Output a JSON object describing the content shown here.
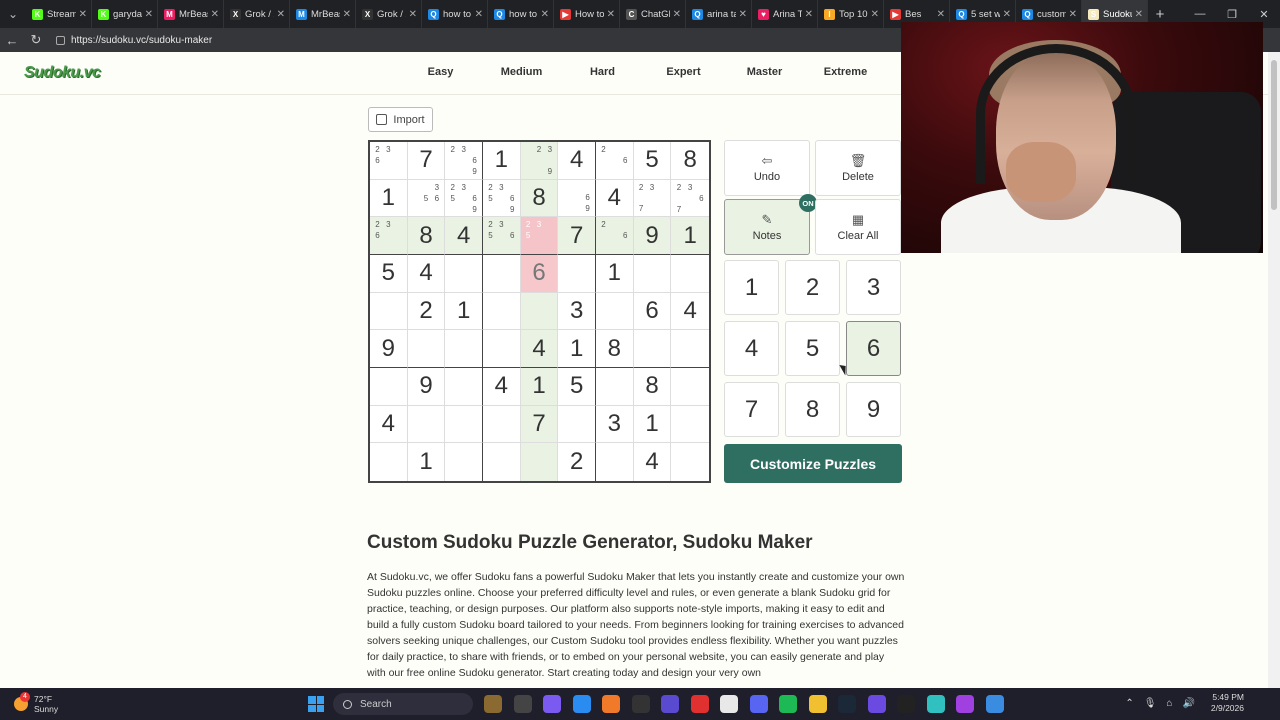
{
  "browser": {
    "tabs": [
      {
        "label": "Stream",
        "color": "#53fc18",
        "glyph": "K"
      },
      {
        "label": "garydan",
        "color": "#53fc18",
        "glyph": "K"
      },
      {
        "label": "MrBeast",
        "color": "#e91e63",
        "glyph": "M"
      },
      {
        "label": "Grok / X",
        "color": "#333",
        "glyph": "X"
      },
      {
        "label": "MrBeast",
        "color": "#1e88e5",
        "glyph": "M"
      },
      {
        "label": "Grok / X",
        "color": "#333",
        "glyph": "X"
      },
      {
        "label": "how to",
        "color": "#1e88e5",
        "glyph": "Q"
      },
      {
        "label": "how to",
        "color": "#1e88e5",
        "glyph": "Q"
      },
      {
        "label": "How to",
        "color": "#e53935",
        "glyph": "▶"
      },
      {
        "label": "ChatGPT",
        "color": "#555",
        "glyph": "C"
      },
      {
        "label": "arina ta",
        "color": "#1e88e5",
        "glyph": "Q"
      },
      {
        "label": "Arina Ta",
        "color": "#e91e63",
        "glyph": "♥"
      },
      {
        "label": "Top 10",
        "color": "#f9a825",
        "glyph": "I"
      },
      {
        "label": "Bes",
        "color": "#e53935",
        "glyph": "▶"
      },
      {
        "label": "5 set w",
        "color": "#1e88e5",
        "glyph": "Q"
      },
      {
        "label": "custom",
        "color": "#1e88e5",
        "glyph": "Q"
      },
      {
        "label": "Sudoku",
        "color": "#f5e9c0",
        "glyph": "S"
      }
    ],
    "url": "https://sudoku.vc/sudoku-maker"
  },
  "site": {
    "logo": "Sudoku.vc",
    "nav": [
      "Easy",
      "Medium",
      "Hard",
      "Expert",
      "Master",
      "Extreme"
    ],
    "import_label": "Import"
  },
  "grid": {
    "cells": [
      {
        "n": "2 3 _ 6"
      },
      {
        "v": "7"
      },
      {
        "n": "2 3 _ _ _ 6 _ _ 9"
      },
      {
        "v": "1"
      },
      {
        "n": "_ 2 3 _ _ _ _ _ 9",
        "hl": 1
      },
      {
        "v": "4"
      },
      {
        "n": "2 _ _ _ _ 6"
      },
      {
        "v": "5"
      },
      {
        "v": "8"
      },
      {
        "v": "1"
      },
      {
        "n": "_ _ 3 _ 5 6"
      },
      {
        "n": "2 3 _ 5 _ 6 _ _ 9"
      },
      {
        "n": "2 3 _ 5 _ 6 _ _ 9"
      },
      {
        "v": "8",
        "hl": 1
      },
      {
        "n": "_ _ _ _ _ 6 _ _ 9"
      },
      {
        "v": "4"
      },
      {
        "n": "2 3 _ _ _ _ 7"
      },
      {
        "n": "2 3 _ _ _ 6 7"
      },
      {
        "n": "2 3 _ 6",
        "hl": 1
      },
      {
        "v": "8",
        "hl": 1
      },
      {
        "v": "4",
        "hl": 1
      },
      {
        "n": "2 3 _ 5 _ 6",
        "hl": 1
      },
      {
        "n": "2 3 _ 5",
        "sel": 1
      },
      {
        "v": "7",
        "hl": 1
      },
      {
        "n": "2 _ _ _ _ 6",
        "hl": 1
      },
      {
        "v": "9",
        "hl": 1
      },
      {
        "v": "1",
        "hl": 1
      },
      {
        "v": "5"
      },
      {
        "v": "4"
      },
      {},
      {},
      {
        "v": "6",
        "focus": 1,
        "user": 1
      },
      {},
      {
        "v": "1"
      },
      {},
      {},
      {},
      {
        "v": "2"
      },
      {
        "v": "1"
      },
      {},
      {
        "hl": 1
      },
      {
        "v": "3"
      },
      {},
      {
        "v": "6"
      },
      {
        "v": "4"
      },
      {
        "v": "9"
      },
      {},
      {},
      {},
      {
        "v": "4",
        "hl": 1
      },
      {
        "v": "1"
      },
      {
        "v": "8"
      },
      {},
      {},
      {},
      {
        "v": "9"
      },
      {},
      {
        "v": "4"
      },
      {
        "v": "1",
        "hl": 1
      },
      {
        "v": "5"
      },
      {},
      {
        "v": "8"
      },
      {},
      {
        "v": "4"
      },
      {},
      {},
      {},
      {
        "v": "7",
        "hl": 1
      },
      {},
      {
        "v": "3"
      },
      {
        "v": "1"
      },
      {},
      {},
      {
        "v": "1"
      },
      {},
      {},
      {
        "hl": 1
      },
      {
        "v": "2"
      },
      {},
      {
        "v": "4"
      },
      {}
    ]
  },
  "controls": {
    "undo": "Undo",
    "delete": "Delete",
    "notes": "Notes",
    "notes_badge": "ON",
    "clear_all": "Clear All",
    "numbers": [
      "1",
      "2",
      "3",
      "4",
      "5",
      "6",
      "7",
      "8",
      "9"
    ],
    "active_number": "6",
    "customize": "Customize Puzzles"
  },
  "article": {
    "title": "Custom Sudoku Puzzle Generator, Sudoku Maker",
    "body": "At Sudoku.vc, we offer Sudoku fans a powerful Sudoku Maker that lets you instantly create and customize your own Sudoku puzzles online. Choose your preferred difficulty level and rules, or even generate a blank Sudoku grid for practice, teaching, or design purposes. Our platform also supports note-style imports, making it easy to edit and build a fully custom Sudoku board tailored to your needs. From beginners looking for training exercises to advanced solvers seeking unique challenges, our Custom Sudoku tool provides endless flexibility. Whether you want puzzles for daily practice, to share with friends, or to embed on your personal website, you can easily generate and play with our free online Sudoku generator. Start creating today and design your very own"
  },
  "taskbar": {
    "weather_temp": "72°F",
    "weather_desc": "Sunny",
    "weather_badge": "4",
    "search_label": "Search",
    "time": "5:49 PM",
    "date": "2/9/2026",
    "icon_colors": [
      "#8a6a30",
      "#444",
      "#7a5af0",
      "#2a8cf0",
      "#f07a2a",
      "#333",
      "#5a4ad0",
      "#e03030",
      "#e8e8e8",
      "#5865f2",
      "#1db954",
      "#f0c030",
      "#1b2838",
      "#6a4ae0",
      "#222",
      "#30c0c0",
      "#a040e0",
      "#3a8ce0"
    ]
  }
}
